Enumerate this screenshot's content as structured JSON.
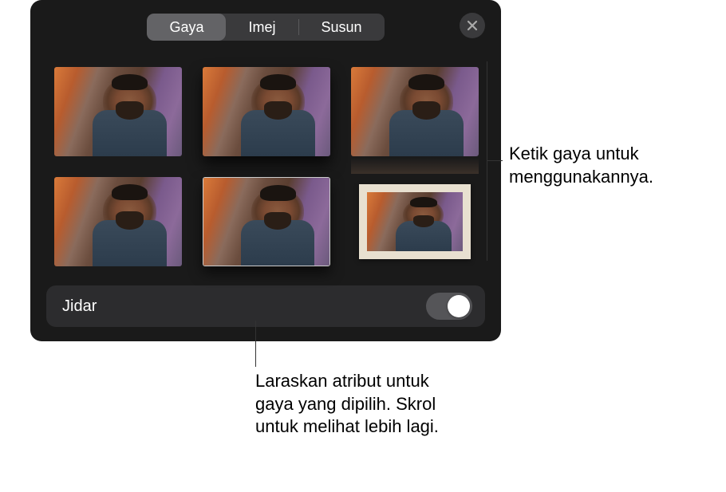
{
  "tabs": {
    "style": "Gaya",
    "image": "Imej",
    "arrange": "Susun"
  },
  "controls": {
    "border_label": "Jidar"
  },
  "callouts": {
    "right": "Ketik gaya untuk menggunakannya.",
    "bottom": "Laraskan atribut untuk gaya yang dipilih. Skrol untuk melihat lebih lagi."
  },
  "styles": [
    {
      "key": "plain",
      "variant": "none"
    },
    {
      "key": "shadow",
      "variant": "shadow"
    },
    {
      "key": "reflect",
      "variant": "reflect"
    },
    {
      "key": "plain2",
      "variant": "none"
    },
    {
      "key": "thin-border",
      "variant": "border-thin"
    },
    {
      "key": "frame",
      "variant": "frame",
      "selected": true
    }
  ]
}
